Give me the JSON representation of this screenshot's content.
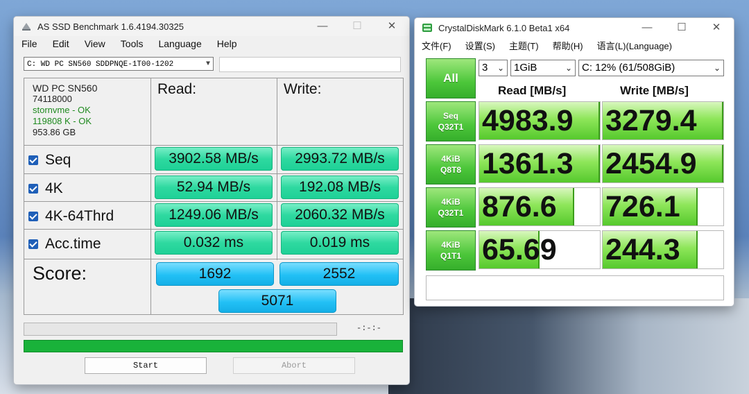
{
  "asssd": {
    "title": "AS SSD Benchmark 1.6.4194.30325",
    "menu": [
      "File",
      "Edit",
      "View",
      "Tools",
      "Language",
      "Help"
    ],
    "drive_select": "C: WD PC SN560 SDDPNQE-1T00-1202",
    "info": {
      "model": "WD PC SN560",
      "firmware": "74118000",
      "driver_status": "stornvme - OK",
      "alignment_status": "119808 K - OK",
      "capacity": "953.86 GB"
    },
    "headers": {
      "read": "Read:",
      "write": "Write:"
    },
    "rows": [
      {
        "label": "Seq",
        "read": "3902.58 MB/s",
        "write": "2993.72 MB/s"
      },
      {
        "label": "4K",
        "read": "52.94 MB/s",
        "write": "192.08 MB/s"
      },
      {
        "label": "4K-64Thrd",
        "read": "1249.06 MB/s",
        "write": "2060.32 MB/s"
      },
      {
        "label": "Acc.time",
        "read": "0.032 ms",
        "write": "0.019 ms"
      }
    ],
    "score_label": "Score:",
    "score_read": "1692",
    "score_write": "2552",
    "score_total": "5071",
    "time_display": "-:-:-",
    "progress_fraction": 1.0,
    "buttons": {
      "start": "Start",
      "abort": "Abort"
    }
  },
  "cdm": {
    "title": "CrystalDiskMark 6.1.0 Beta1 x64",
    "menu": [
      "文件(F)",
      "设置(S)",
      "主题(T)",
      "帮助(H)",
      "语言(L)(Language)"
    ],
    "all_button": "All",
    "count": "3",
    "size": "1GiB",
    "drive": "C: 12% (61/508GiB)",
    "read_header": "Read [MB/s]",
    "write_header": "Write [MB/s]",
    "tests": [
      {
        "line1": "Seq",
        "line2": "Q32T1",
        "read": "4983.9",
        "write": "3279.4",
        "read_fill": 1.0,
        "write_fill": 1.0
      },
      {
        "line1": "4KiB",
        "line2": "Q8T8",
        "read": "1361.3",
        "write": "2454.9",
        "read_fill": 1.0,
        "write_fill": 1.0
      },
      {
        "line1": "4KiB",
        "line2": "Q32T1",
        "read": "876.6",
        "write": "726.1",
        "read_fill": 0.79,
        "write_fill": 0.79
      },
      {
        "line1": "4KiB",
        "line2": "Q1T1",
        "read": "65.69",
        "write": "244.3",
        "read_fill": 0.5,
        "write_fill": 0.79
      }
    ],
    "status": ""
  }
}
